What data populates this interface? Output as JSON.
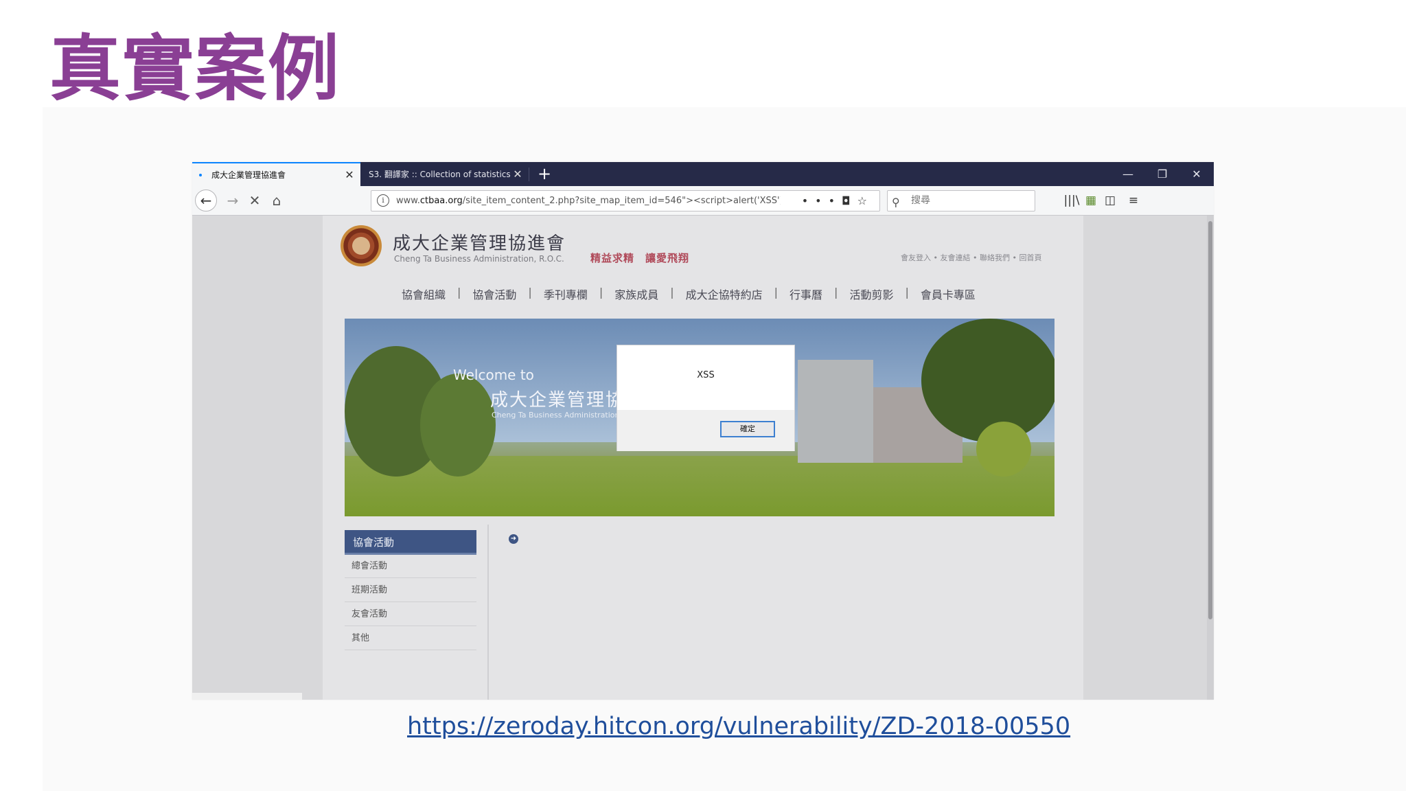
{
  "slide": {
    "title": "真實案例",
    "reference_link": "https://zeroday.hitcon.org/vulnerability/ZD-2018-00550"
  },
  "browser": {
    "tabs": [
      {
        "label": "成大企業管理協進會",
        "active": true
      },
      {
        "label": "S3. 翻譯家 :: Collection of statistics",
        "active": false
      }
    ],
    "url_prefix": "www.",
    "url_domain": "ctbaa.org",
    "url_path": "/site_item_content_2.php?site_map_item_id=546\"><script>alert('XSS')",
    "search_placeholder": "搜尋",
    "icons": {
      "back": "back-arrow-icon",
      "forward": "forward-arrow-icon",
      "stop": "stop-icon",
      "home": "home-icon",
      "info": "info-icon",
      "page_actions": "more-dots-icon",
      "pocket": "pocket-icon",
      "bookmark": "star-icon",
      "search": "search-icon",
      "library": "library-icon",
      "extension": "extension-icon",
      "sidebar": "sidebar-icon",
      "menu": "hamburger-menu-icon"
    }
  },
  "website": {
    "name": "成大企業管理協進會",
    "english_name": "Cheng Ta Business Administration, R.O.C.",
    "slogan": "精益求精　讓愛飛翔",
    "top_links": "會友登入 • 友會連結 • 聯絡我們 • 回首頁",
    "menu": [
      "協會組織",
      "協會活動",
      "季刊專欄",
      "家族成員",
      "成大企協特約店",
      "行事曆",
      "活動剪影",
      "會員卡專區"
    ],
    "banner": {
      "welcome": "Welcome to",
      "name": "成大企業管理協進會",
      "english": "Cheng Ta Business Administration"
    },
    "sidebar": {
      "heading": "協會活動",
      "items": [
        "總會活動",
        "班期活動",
        "友會活動",
        "其他"
      ]
    }
  },
  "alert_dialog": {
    "message": "XSS",
    "ok_label": "確定"
  }
}
